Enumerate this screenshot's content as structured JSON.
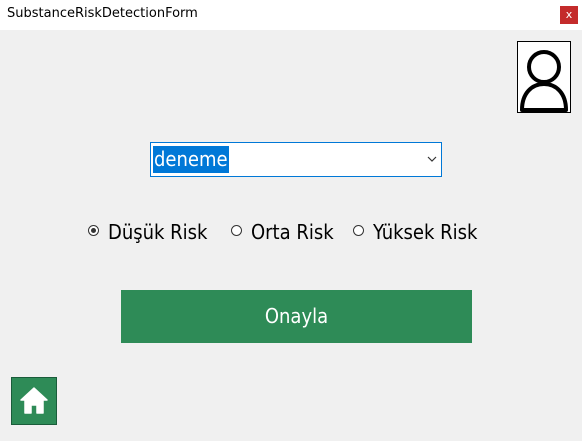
{
  "window": {
    "title": "SubstanceRiskDetectionForm",
    "close_label": "x"
  },
  "substance_select": {
    "selected_value": "deneme"
  },
  "risk_level": {
    "options": [
      {
        "label": "Düşük Risk",
        "checked": true
      },
      {
        "label": "Orta Risk",
        "checked": false
      },
      {
        "label": "Yüksek Risk",
        "checked": false
      }
    ]
  },
  "confirm_button": {
    "label": "Onayla"
  },
  "icons": {
    "avatar": "user-avatar-icon",
    "home": "home-icon",
    "dropdown": "chevron-down-icon"
  },
  "colors": {
    "accent_green": "#2e8b57",
    "selection_blue": "#0078d7",
    "close_red": "#c42b2b",
    "background": "#f0f0f0"
  }
}
